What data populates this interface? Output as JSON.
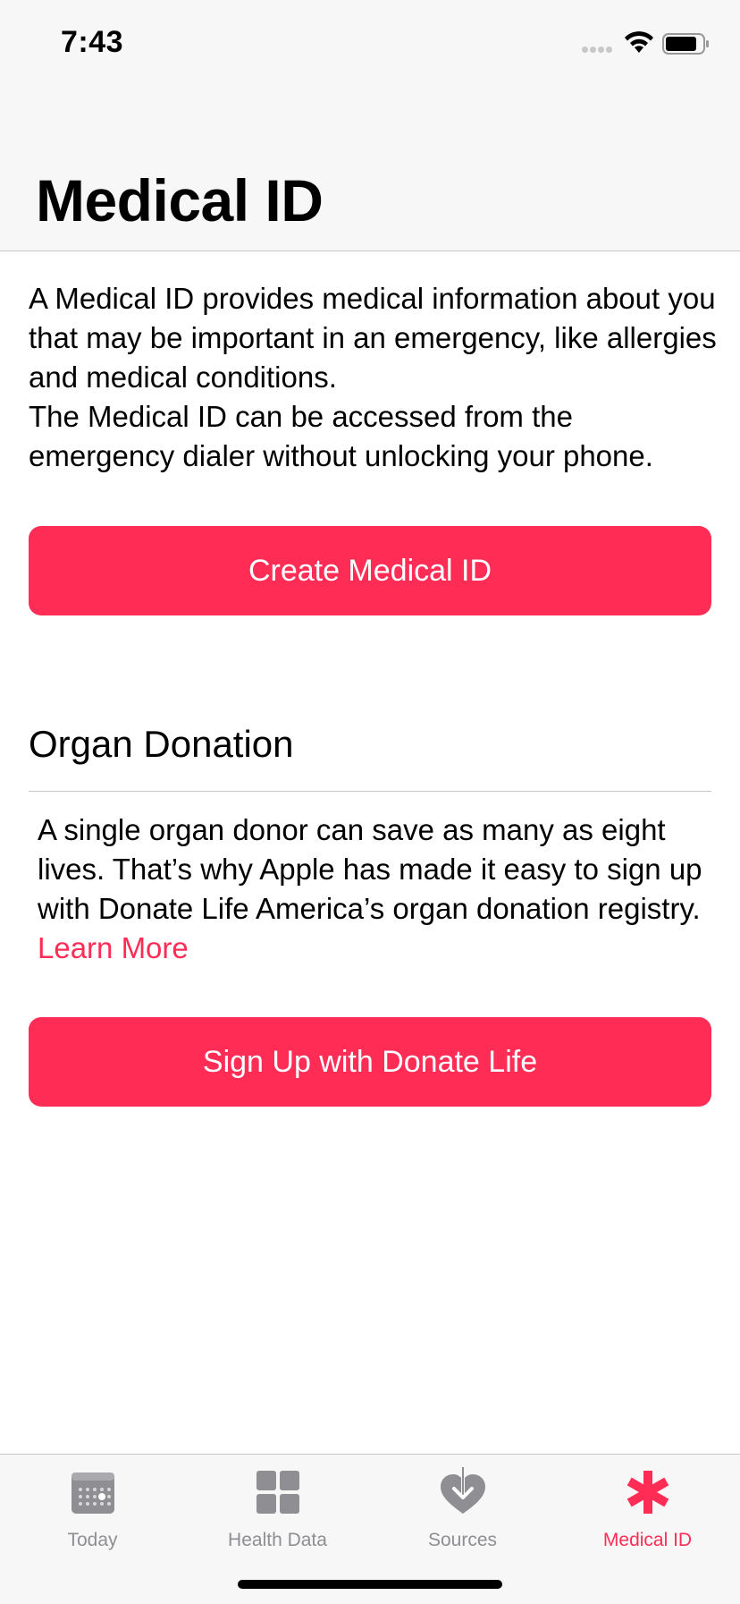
{
  "status_bar": {
    "time": "7:43"
  },
  "header": {
    "title": "Medical ID"
  },
  "intro": {
    "paragraph_1": "A Medical ID provides medical information about you that may be important in an emergency, like allergies and medical conditions.",
    "paragraph_2": "The Medical ID can be accessed from the emergency dialer without unlocking your phone."
  },
  "create_button": {
    "label": "Create Medical ID"
  },
  "organ_donation": {
    "title": "Organ Donation",
    "text": "A single organ donor can save as many as eight lives. That’s why Apple has made it easy to sign up with Donate Life America’s organ donation registry.",
    "link_label": "Learn More",
    "button_label": "Sign Up with Donate Life"
  },
  "tab_bar": {
    "tabs": [
      {
        "label": "Today",
        "icon": "calendar-icon",
        "active": false
      },
      {
        "label": "Health Data",
        "icon": "grid-icon",
        "active": false
      },
      {
        "label": "Sources",
        "icon": "heart-download-icon",
        "active": false
      },
      {
        "label": "Medical ID",
        "icon": "asterisk-icon",
        "active": true
      }
    ]
  },
  "colors": {
    "accent": "#ff2d55",
    "inactive_tab": "#8e8e93",
    "bar_background": "#f7f7f7",
    "separator": "#c6c6c8"
  }
}
